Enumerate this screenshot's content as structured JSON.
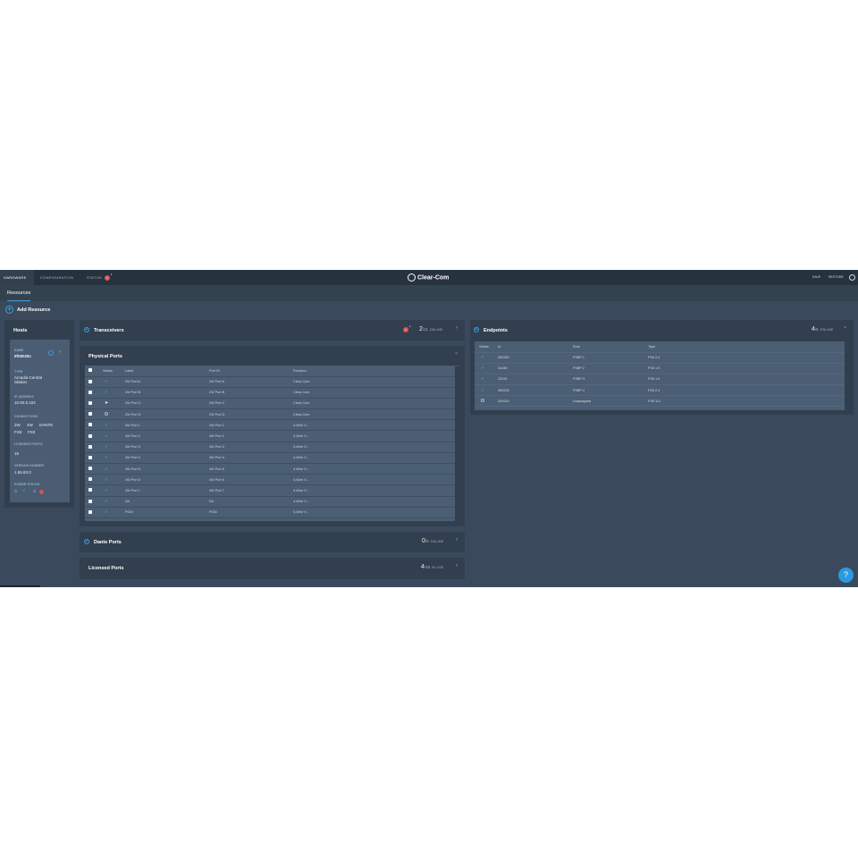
{
  "topbar": {
    "tabs": [
      {
        "label": "HARDWARE"
      },
      {
        "label": "CONFIGURATION"
      },
      {
        "label": "STATUS",
        "badge": "×",
        "badge_count": "1"
      }
    ],
    "logo": "Clear-Com",
    "save_label": "SAVE",
    "restore_label": "RESTORE",
    "globe_icon": "globe-icon"
  },
  "subtabs": {
    "resources": "Resources"
  },
  "add_resource": {
    "label": "Add Resource",
    "icon": "plus-icon"
  },
  "hosts": {
    "title": "Hosts",
    "card": {
      "name_label": "NAME",
      "name": "9f08028c",
      "type_label": "TYPE",
      "type": "Arcadia Central Station",
      "ip_label": "IP ADDRESS",
      "ip": "10.50.5.102",
      "connections_label": "CONNECTIONS",
      "connections": [
        "2W",
        "4W",
        "DANTE",
        "FSE",
        "FSII"
      ],
      "licensed_label": "LICENSED PORTS",
      "licensed": "16",
      "version_label": "VERSION NUMBER",
      "version": "1.55.83.0",
      "power_label": "POWER STATUS"
    }
  },
  "transceivers": {
    "title": "Transceivers",
    "alert_count": "1",
    "online": "2",
    "total": "/11",
    "status": "ONLINE"
  },
  "physical_ports": {
    "title": "Physical Ports",
    "headers": [
      "Status",
      "Label",
      "Port ID",
      "Function"
    ],
    "rows": [
      {
        "status": "ok",
        "label": "2W Port A",
        "port_id": "2W Port A",
        "function": "Clear-Com"
      },
      {
        "status": "ok",
        "label": "2W Port B",
        "port_id": "2W Port B",
        "function": "Clear-Com"
      },
      {
        "status": "cursor",
        "label": "2W Port C",
        "port_id": "2W Port C",
        "function": "Clear-Com"
      },
      {
        "status": "off",
        "label": "2W Port D",
        "port_id": "2W Port D",
        "function": "Clear-Com"
      },
      {
        "status": "ok",
        "label": "4W Port 1",
        "port_id": "4W Port 1",
        "function": "4-Wire X..."
      },
      {
        "status": "ok",
        "label": "4W Port 2",
        "port_id": "4W Port 2",
        "function": "4-Wire X..."
      },
      {
        "status": "ok",
        "label": "4W Port 3",
        "port_id": "4W Port 3",
        "function": "4-Wire X..."
      },
      {
        "status": "ok",
        "label": "4W Port 4",
        "port_id": "4W Port 4",
        "function": "4-Wire X..."
      },
      {
        "status": "ok",
        "label": "4W Port 5",
        "port_id": "4W Port 5",
        "function": "4-Wire X..."
      },
      {
        "status": "ok",
        "label": "4W Port 6",
        "port_id": "4W Port 6",
        "function": "4-Wire X..."
      },
      {
        "status": "ok",
        "label": "4W Port 7",
        "port_id": "4W Port 7",
        "function": "4-Wire X..."
      },
      {
        "status": "ok",
        "label": "SA",
        "port_id": "SA",
        "function": "4-Wire X..."
      },
      {
        "status": "ok",
        "label": "PGM",
        "port_id": "PGM",
        "function": "4-Wire X..."
      }
    ]
  },
  "dante_ports": {
    "title": "Dante Ports",
    "online": "0",
    "total": "/3",
    "status": "ONLINE"
  },
  "licensed_ports": {
    "title": "Licensed Ports",
    "used": "4",
    "total": "/16",
    "status": "IN USE"
  },
  "endpoints": {
    "title": "Endpoints",
    "online": "4",
    "total": "/5",
    "status": "ONLINE",
    "headers": [
      "Status",
      "Id",
      "Role",
      "Type"
    ],
    "rows": [
      {
        "status": "ok",
        "id": "282952",
        "role": "FSBP 1",
        "type": "FSII 2.4"
      },
      {
        "status": "ok",
        "id": "31448",
        "role": "FSBP 2",
        "type": "FSII 1.9"
      },
      {
        "status": "ok",
        "id": "22031",
        "role": "FSBP 3",
        "type": "FSII 1.9"
      },
      {
        "status": "ok",
        "id": "282976",
        "role": "FSBP 4",
        "type": "FSII 2.4"
      },
      {
        "status": "off",
        "id": "329219",
        "role": "Unassigned",
        "type": "FSE 5.0"
      }
    ]
  },
  "help": {
    "label": "?"
  }
}
